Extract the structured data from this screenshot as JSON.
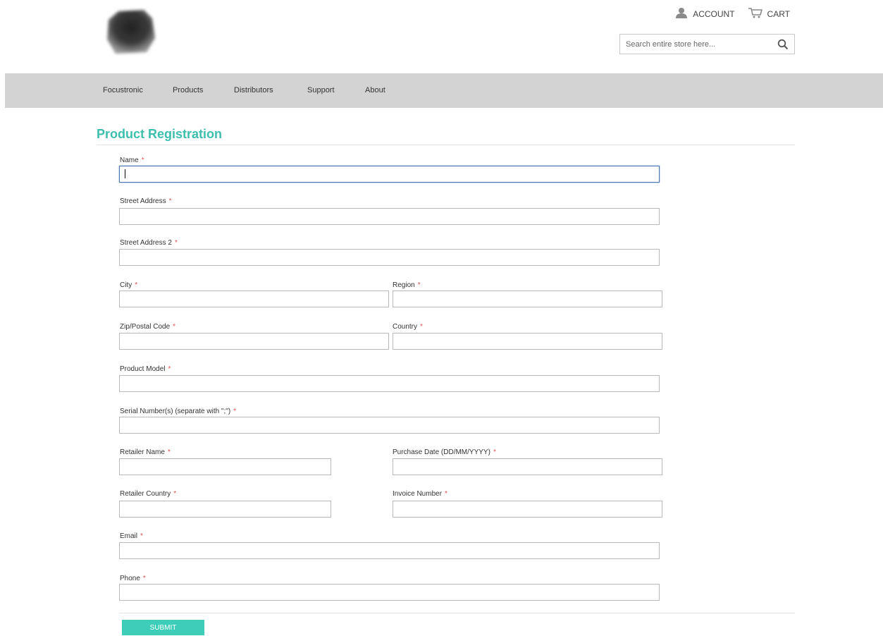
{
  "header": {
    "logo_icon": "blurred-logo-icon",
    "account_label": "ACCOUNT",
    "account_icon": "user-icon",
    "cart_label": "CART",
    "cart_icon": "cart-icon",
    "search": {
      "placeholder": "Search entire store here...",
      "icon": "search-icon"
    }
  },
  "nav": {
    "items": [
      {
        "label": "Focustronic"
      },
      {
        "label": "Products"
      },
      {
        "label": "Distributors"
      },
      {
        "label": "Support"
      },
      {
        "label": "About"
      }
    ]
  },
  "form": {
    "title": "Product Registration",
    "required_marker": "*",
    "fields": [
      {
        "label": "Name",
        "value": ""
      },
      {
        "label": "Street Address",
        "value": ""
      },
      {
        "label": "Street Address 2",
        "value": ""
      },
      {
        "label": "City",
        "value": ""
      },
      {
        "label": "Region",
        "value": ""
      },
      {
        "label": "Zip/Postal Code",
        "value": ""
      },
      {
        "label": "Country",
        "value": ""
      },
      {
        "label": "Product Model",
        "value": ""
      },
      {
        "label": "Serial Number(s) (separate with \";\")",
        "value": ""
      },
      {
        "label": "Retailer Name",
        "value": ""
      },
      {
        "label": "Purchase Date (DD/MM/YYYY)",
        "value": ""
      },
      {
        "label": "Retailer Country",
        "value": ""
      },
      {
        "label": "Invoice Number",
        "value": ""
      },
      {
        "label": "Email",
        "value": ""
      },
      {
        "label": "Phone",
        "value": ""
      }
    ],
    "submit_label": "SUBMIT"
  },
  "colors": {
    "accent": "#3dbfae",
    "submit_bg": "#3dcdb8",
    "nav_bg": "#d3d3d3",
    "required": "#e05252",
    "focus_border": "#4a74b0"
  }
}
